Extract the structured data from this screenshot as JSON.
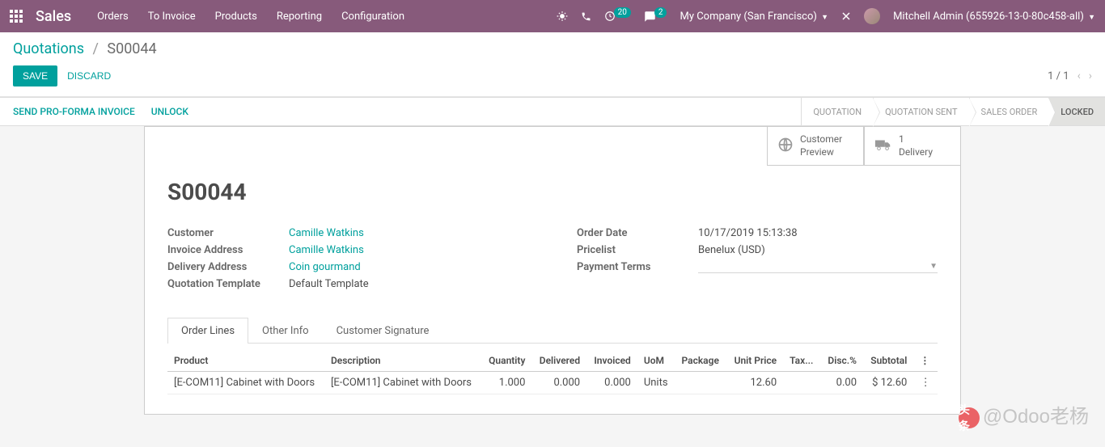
{
  "nav": {
    "app": "Sales",
    "menus": [
      "Orders",
      "To Invoice",
      "Products",
      "Reporting",
      "Configuration"
    ],
    "activity_badge": "20",
    "msg_badge": "2",
    "company": "My Company (San Francisco)",
    "user": "Mitchell Admin (655926-13-0-80c458-all)"
  },
  "breadcrumb": {
    "root": "Quotations",
    "current": "S00044"
  },
  "actions": {
    "save": "SAVE",
    "discard": "DISCARD"
  },
  "pager": {
    "text": "1 / 1"
  },
  "status_actions": {
    "proforma": "SEND PRO-FORMA INVOICE",
    "unlock": "UNLOCK"
  },
  "status_steps": [
    "QUOTATION",
    "QUOTATION SENT",
    "SALES ORDER",
    "LOCKED"
  ],
  "stat_buttons": {
    "preview": {
      "line1": "Customer",
      "line2": "Preview"
    },
    "delivery": {
      "line1": "1",
      "line2": "Delivery"
    }
  },
  "order": {
    "name": "S00044",
    "labels": {
      "customer": "Customer",
      "invoice_addr": "Invoice Address",
      "delivery_addr": "Delivery Address",
      "template": "Quotation Template",
      "order_date": "Order Date",
      "pricelist": "Pricelist",
      "payment_terms": "Payment Terms"
    },
    "customer": "Camille Watkins",
    "invoice_addr": "Camille Watkins",
    "delivery_addr": "Coin gourmand",
    "template": "Default Template",
    "order_date": "10/17/2019 15:13:38",
    "pricelist": "Benelux (USD)",
    "payment_terms": ""
  },
  "tabs": [
    "Order Lines",
    "Other Info",
    "Customer Signature"
  ],
  "table": {
    "headers": {
      "product": "Product",
      "description": "Description",
      "quantity": "Quantity",
      "delivered": "Delivered",
      "invoiced": "Invoiced",
      "uom": "UoM",
      "package": "Package",
      "unit_price": "Unit Price",
      "taxes": "Tax...",
      "disc": "Disc.%",
      "subtotal": "Subtotal"
    },
    "rows": [
      {
        "product": "[E-COM11] Cabinet with Doors",
        "description": "[E-COM11] Cabinet with Doors",
        "quantity": "1.000",
        "delivered": "0.000",
        "invoiced": "0.000",
        "uom": "Units",
        "package": "",
        "unit_price": "12.60",
        "taxes": "",
        "disc": "0.00",
        "subtotal": "$ 12.60"
      }
    ]
  },
  "watermark": "@Odoo老杨"
}
